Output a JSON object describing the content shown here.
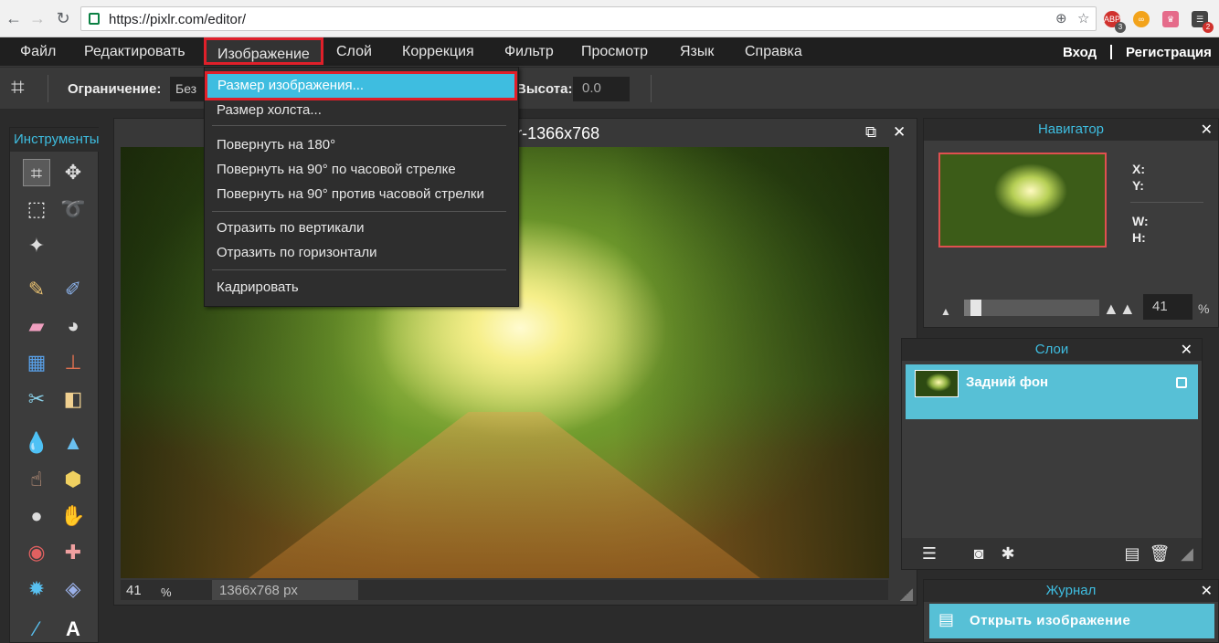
{
  "browser": {
    "url": "https://pixlr.com/editor/",
    "back_icon": "←",
    "forward_icon": "→",
    "reload_icon": "↻",
    "zoom_icon": "⊕",
    "star_icon": "☆",
    "ext_abp_badge": "3",
    "ext_menu_badge": "2"
  },
  "menubar": {
    "items": [
      "Файл",
      "Редактировать",
      "Изображение",
      "Слой",
      "Коррекция",
      "Фильтр",
      "Просмотр",
      "Язык",
      "Справка"
    ],
    "login": "Вход",
    "register": "Регистрация"
  },
  "options": {
    "constraint_label": "Ограничение:",
    "constraint_value": "Без",
    "height_label": "Высота:",
    "height_value": "0.0"
  },
  "tools": {
    "title": "Инструменты"
  },
  "document": {
    "title": "autumn_path-wallpaper-1366x768",
    "zoom": "41",
    "zoom_unit": "%",
    "dimensions": "1366x768 px"
  },
  "image_menu": {
    "items": [
      "Размер изображения...",
      "Размер холста...",
      "Повернуть на 180°",
      "Повернуть на 90° по часовой стрелке",
      "Повернуть на 90° против часовой стрелки",
      "Отразить по вертикали",
      "Отразить по горизонтали",
      "Кадрировать"
    ]
  },
  "navigator": {
    "title": "Навигатор",
    "x_label": "X:",
    "y_label": "Y:",
    "w_label": "W:",
    "h_label": "H:",
    "zoom_value": "41",
    "zoom_unit": "%",
    "zoom_level_fraction": 0.05
  },
  "layers": {
    "title": "Слои",
    "items": [
      {
        "name": "Задний фон"
      }
    ]
  },
  "history": {
    "title": "Журнал",
    "items": [
      "Открыть изображение"
    ]
  },
  "colors": {
    "accent": "#3ebde0",
    "highlight_border": "#e0202a",
    "layer_selected": "#57c0d6"
  }
}
